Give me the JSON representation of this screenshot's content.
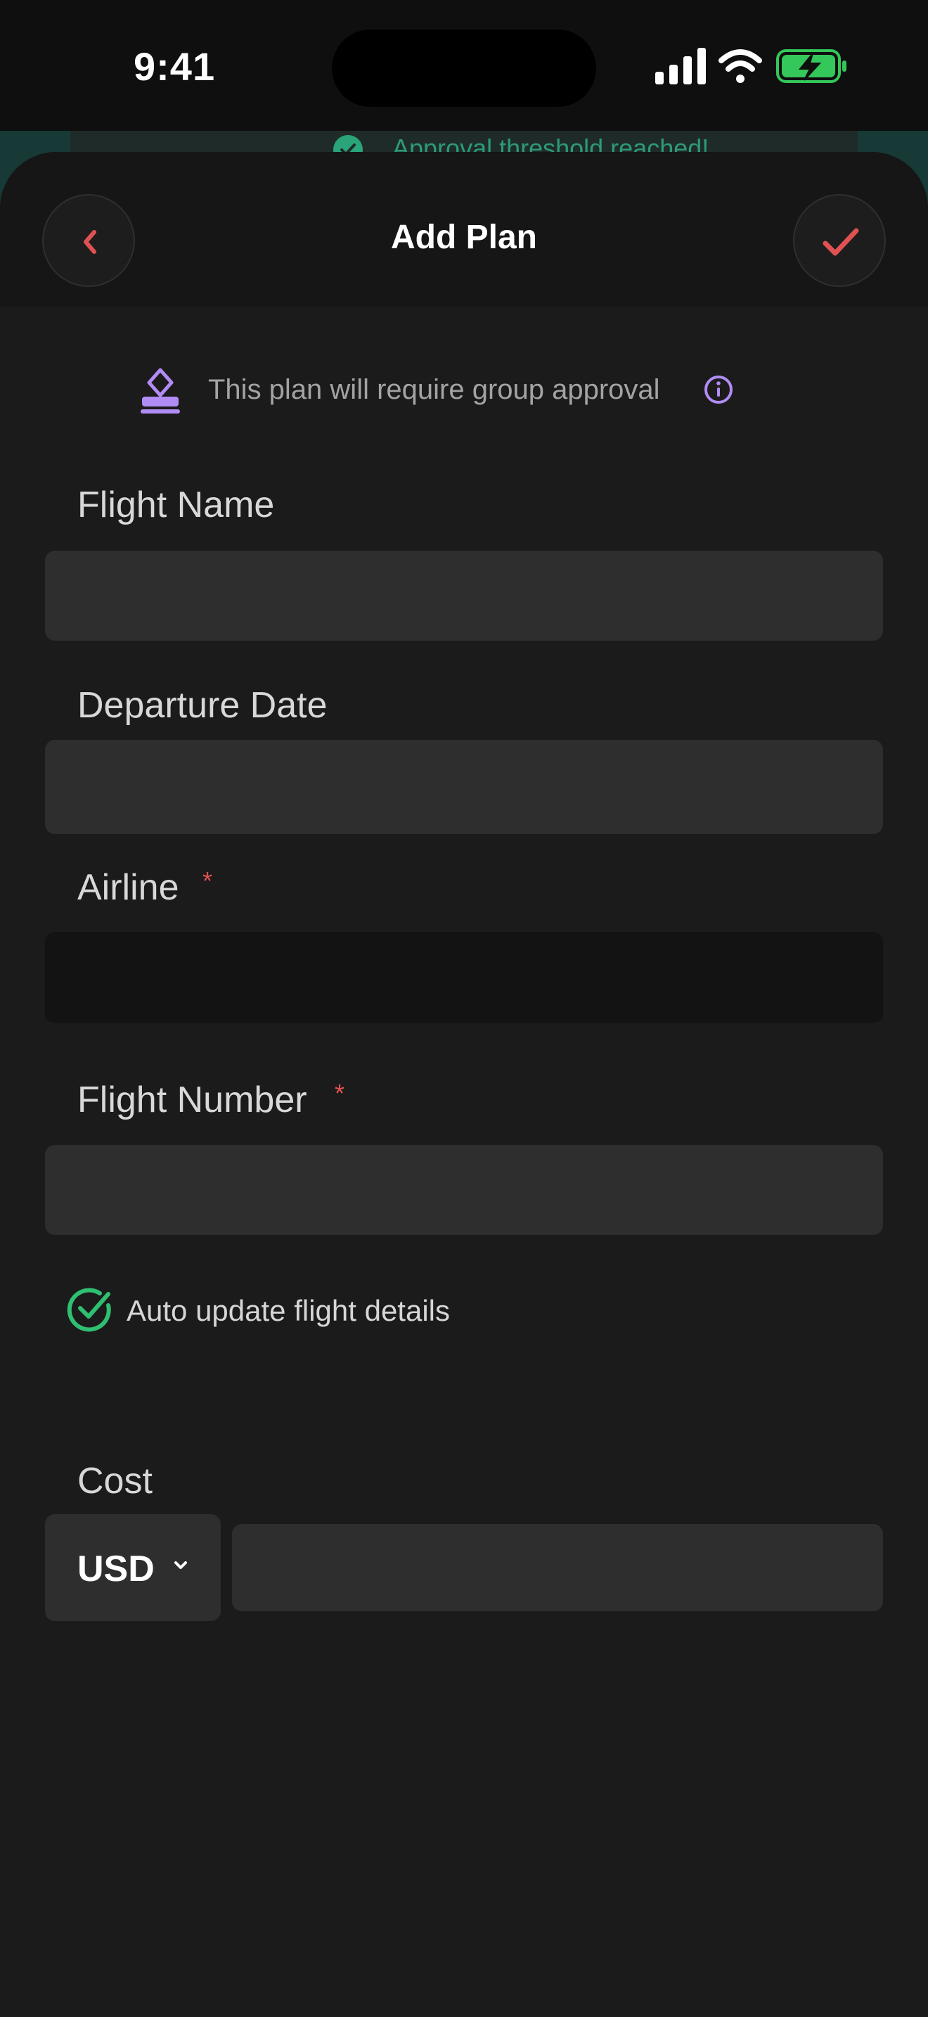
{
  "status_bar": {
    "time": "9:41",
    "icons": [
      "cellular-signal",
      "wifi",
      "battery-charging"
    ],
    "battery_color": "#34c759"
  },
  "background": {
    "banner_text": "Approval threshold reached!",
    "banner_color": "#2d9a76"
  },
  "header": {
    "title": "Add Plan",
    "back_icon": "chevron-left-icon",
    "done_icon": "checkmark-icon",
    "accent_color": "#e05252"
  },
  "approval": {
    "text": "This plan will require group approval",
    "icon": "approval-stamp-icon",
    "info_icon": "info-icon",
    "icon_color": "#b18cf5"
  },
  "form": {
    "flight_name": {
      "label": "Flight Name",
      "value": "",
      "placeholder": ""
    },
    "departure_date": {
      "label": "Departure Date",
      "value": "",
      "placeholder": ""
    },
    "airline": {
      "label": "Airline",
      "required_mark": "*",
      "value": "",
      "placeholder": ""
    },
    "flight_number": {
      "label": "Flight Number",
      "required_mark": "*",
      "value": "",
      "placeholder": ""
    },
    "auto_update": {
      "label": "Auto update flight details",
      "checked": true,
      "color": "#2fbf71"
    },
    "cost": {
      "label": "Cost",
      "currency": "USD",
      "value": "",
      "placeholder": ""
    }
  }
}
